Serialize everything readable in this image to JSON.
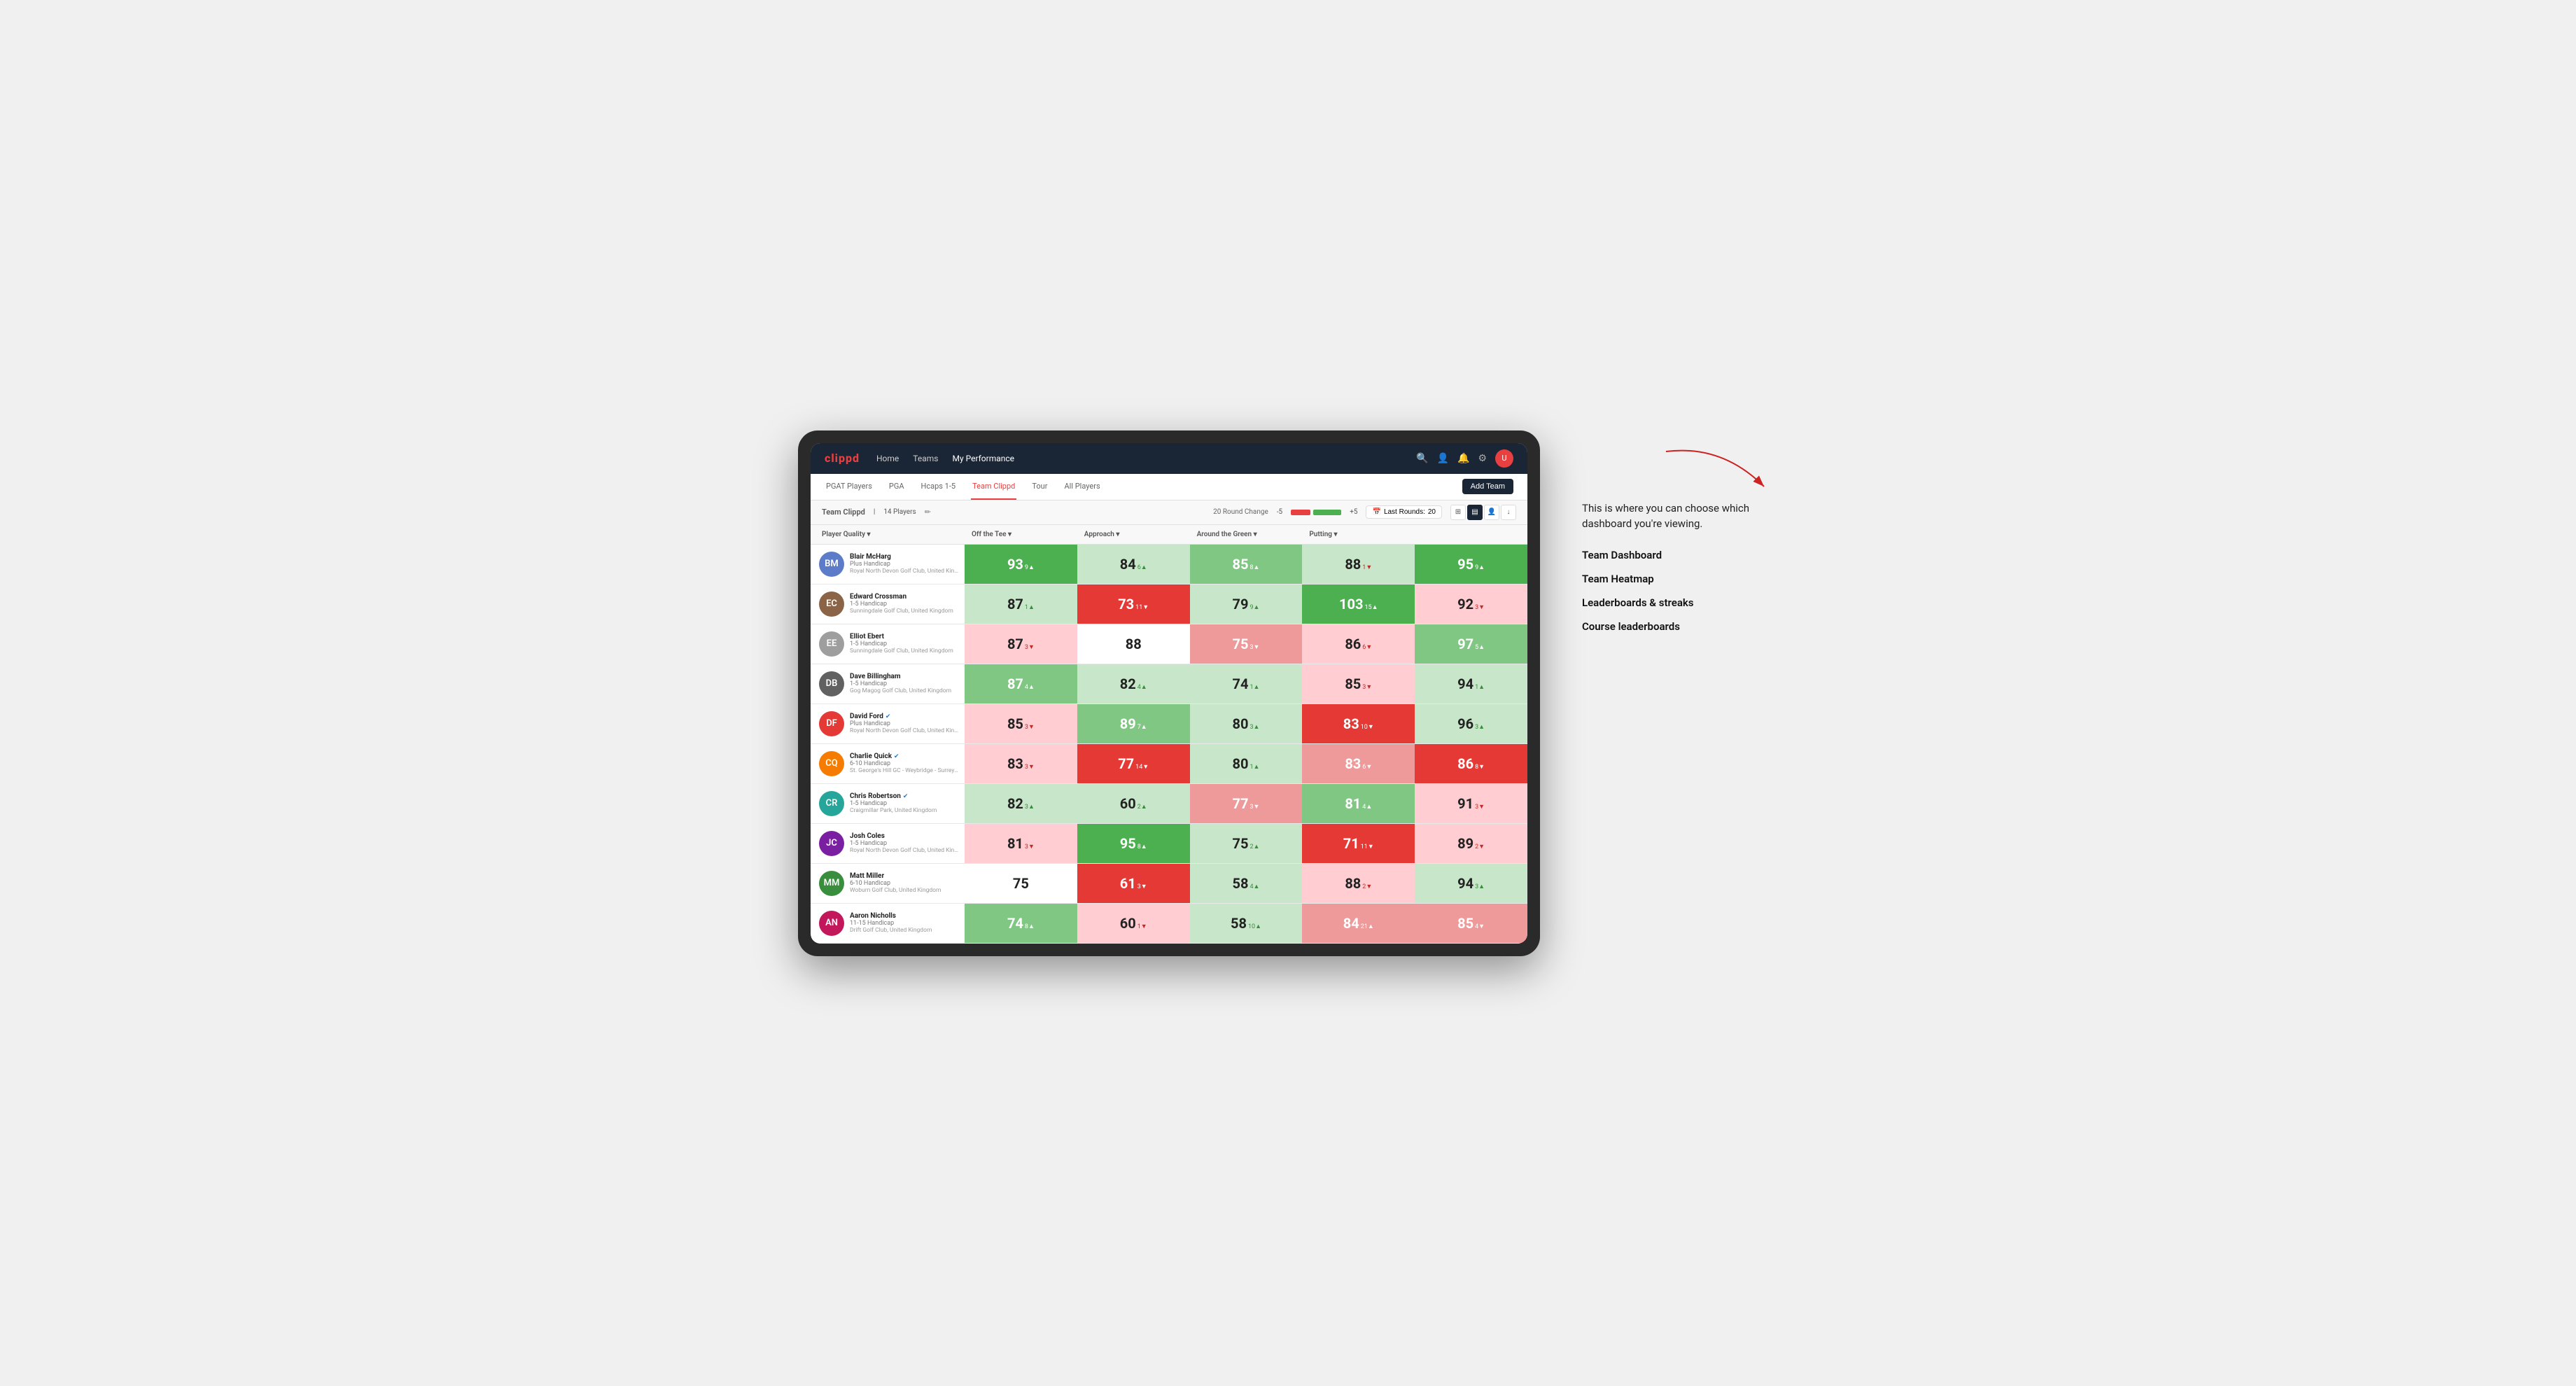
{
  "annotation": {
    "text": "This is where you can choose which dashboard you're viewing.",
    "items": [
      "Team Dashboard",
      "Team Heatmap",
      "Leaderboards & streaks",
      "Course leaderboards"
    ]
  },
  "nav": {
    "logo": "clippd",
    "links": [
      "Home",
      "Teams",
      "My Performance"
    ],
    "active_link": "My Performance"
  },
  "sub_nav": {
    "links": [
      "PGAT Players",
      "PGA",
      "Hcaps 1-5",
      "Team Clippd",
      "Tour",
      "All Players"
    ],
    "active": "Team Clippd",
    "add_team_label": "Add Team"
  },
  "table_controls": {
    "team_label": "Team Clippd",
    "player_count": "14 Players",
    "round_change_label": "20 Round Change",
    "change_low": "-5",
    "change_high": "+5",
    "last_rounds_label": "Last Rounds:",
    "last_rounds_value": "20"
  },
  "col_headers": [
    "Player Quality ▾",
    "Off the Tee ▾",
    "Approach ▾",
    "Around the Green ▾",
    "Putting ▾"
  ],
  "players": [
    {
      "name": "Blair McHarg",
      "handicap": "Plus Handicap",
      "club": "Royal North Devon Golf Club, United Kingdom",
      "avatar_color": "av-blue",
      "initials": "BM",
      "scores": [
        {
          "value": "93",
          "delta": "9",
          "dir": "up",
          "bg": "bg-green-strong"
        },
        {
          "value": "84",
          "delta": "6",
          "dir": "up",
          "bg": "bg-green-light"
        },
        {
          "value": "85",
          "delta": "8",
          "dir": "up",
          "bg": "bg-green-medium"
        },
        {
          "value": "88",
          "delta": "1",
          "dir": "down",
          "bg": "bg-green-light"
        },
        {
          "value": "95",
          "delta": "9",
          "dir": "up",
          "bg": "bg-green-strong"
        }
      ]
    },
    {
      "name": "Edward Crossman",
      "handicap": "1-5 Handicap",
      "club": "Sunningdale Golf Club, United Kingdom",
      "avatar_color": "av-brown",
      "initials": "EC",
      "scores": [
        {
          "value": "87",
          "delta": "1",
          "dir": "up",
          "bg": "bg-green-light"
        },
        {
          "value": "73",
          "delta": "11",
          "dir": "down",
          "bg": "bg-red-strong"
        },
        {
          "value": "79",
          "delta": "9",
          "dir": "up",
          "bg": "bg-green-light"
        },
        {
          "value": "103",
          "delta": "15",
          "dir": "up",
          "bg": "bg-green-strong"
        },
        {
          "value": "92",
          "delta": "3",
          "dir": "down",
          "bg": "bg-red-light"
        }
      ]
    },
    {
      "name": "Elliot Ebert",
      "handicap": "1-5 Handicap",
      "club": "Sunningdale Golf Club, United Kingdom",
      "avatar_color": "av-gray",
      "initials": "EE",
      "scores": [
        {
          "value": "87",
          "delta": "3",
          "dir": "down",
          "bg": "bg-red-light"
        },
        {
          "value": "88",
          "delta": "",
          "dir": "",
          "bg": "bg-white"
        },
        {
          "value": "75",
          "delta": "3",
          "dir": "down",
          "bg": "bg-red-medium"
        },
        {
          "value": "86",
          "delta": "6",
          "dir": "down",
          "bg": "bg-red-light"
        },
        {
          "value": "97",
          "delta": "5",
          "dir": "up",
          "bg": "bg-green-medium"
        }
      ]
    },
    {
      "name": "Dave Billingham",
      "handicap": "1-5 Handicap",
      "club": "Gog Magog Golf Club, United Kingdom",
      "avatar_color": "av-darkgray",
      "initials": "DB",
      "scores": [
        {
          "value": "87",
          "delta": "4",
          "dir": "up",
          "bg": "bg-green-medium"
        },
        {
          "value": "82",
          "delta": "4",
          "dir": "up",
          "bg": "bg-green-light"
        },
        {
          "value": "74",
          "delta": "1",
          "dir": "up",
          "bg": "bg-green-light"
        },
        {
          "value": "85",
          "delta": "3",
          "dir": "down",
          "bg": "bg-red-light"
        },
        {
          "value": "94",
          "delta": "1",
          "dir": "up",
          "bg": "bg-green-light"
        }
      ]
    },
    {
      "name": "David Ford",
      "handicap": "Plus Handicap",
      "club": "Royal North Devon Golf Club, United Kingdom",
      "avatar_color": "av-red",
      "initials": "DF",
      "verified": true,
      "scores": [
        {
          "value": "85",
          "delta": "3",
          "dir": "down",
          "bg": "bg-red-light"
        },
        {
          "value": "89",
          "delta": "7",
          "dir": "up",
          "bg": "bg-green-medium"
        },
        {
          "value": "80",
          "delta": "3",
          "dir": "up",
          "bg": "bg-green-light"
        },
        {
          "value": "83",
          "delta": "10",
          "dir": "down",
          "bg": "bg-red-strong"
        },
        {
          "value": "96",
          "delta": "3",
          "dir": "up",
          "bg": "bg-green-light"
        }
      ]
    },
    {
      "name": "Charlie Quick",
      "handicap": "6-10 Handicap",
      "club": "St. George's Hill GC - Weybridge - Surrey, Uni...",
      "avatar_color": "av-orange",
      "initials": "CQ",
      "verified": true,
      "scores": [
        {
          "value": "83",
          "delta": "3",
          "dir": "down",
          "bg": "bg-red-light"
        },
        {
          "value": "77",
          "delta": "14",
          "dir": "down",
          "bg": "bg-red-strong"
        },
        {
          "value": "80",
          "delta": "1",
          "dir": "up",
          "bg": "bg-green-light"
        },
        {
          "value": "83",
          "delta": "6",
          "dir": "down",
          "bg": "bg-red-medium"
        },
        {
          "value": "86",
          "delta": "8",
          "dir": "down",
          "bg": "bg-red-strong"
        }
      ]
    },
    {
      "name": "Chris Robertson",
      "handicap": "1-5 Handicap",
      "club": "Craigmillar Park, United Kingdom",
      "avatar_color": "av-teal",
      "initials": "CR",
      "verified": true,
      "scores": [
        {
          "value": "82",
          "delta": "3",
          "dir": "up",
          "bg": "bg-green-light"
        },
        {
          "value": "60",
          "delta": "2",
          "dir": "up",
          "bg": "bg-green-light"
        },
        {
          "value": "77",
          "delta": "3",
          "dir": "down",
          "bg": "bg-red-medium"
        },
        {
          "value": "81",
          "delta": "4",
          "dir": "up",
          "bg": "bg-green-medium"
        },
        {
          "value": "91",
          "delta": "3",
          "dir": "down",
          "bg": "bg-red-light"
        }
      ]
    },
    {
      "name": "Josh Coles",
      "handicap": "1-5 Handicap",
      "club": "Royal North Devon Golf Club, United Kingdom",
      "avatar_color": "av-purple",
      "initials": "JC",
      "scores": [
        {
          "value": "81",
          "delta": "3",
          "dir": "down",
          "bg": "bg-red-light"
        },
        {
          "value": "95",
          "delta": "8",
          "dir": "up",
          "bg": "bg-green-strong"
        },
        {
          "value": "75",
          "delta": "2",
          "dir": "up",
          "bg": "bg-green-light"
        },
        {
          "value": "71",
          "delta": "11",
          "dir": "down",
          "bg": "bg-red-strong"
        },
        {
          "value": "89",
          "delta": "2",
          "dir": "down",
          "bg": "bg-red-light"
        }
      ]
    },
    {
      "name": "Matt Miller",
      "handicap": "6-10 Handicap",
      "club": "Woburn Golf Club, United Kingdom",
      "avatar_color": "av-green",
      "initials": "MM",
      "scores": [
        {
          "value": "75",
          "delta": "",
          "dir": "",
          "bg": "bg-white"
        },
        {
          "value": "61",
          "delta": "3",
          "dir": "down",
          "bg": "bg-red-strong"
        },
        {
          "value": "58",
          "delta": "4",
          "dir": "up",
          "bg": "bg-green-light"
        },
        {
          "value": "88",
          "delta": "2",
          "dir": "down",
          "bg": "bg-red-light"
        },
        {
          "value": "94",
          "delta": "3",
          "dir": "up",
          "bg": "bg-green-light"
        }
      ]
    },
    {
      "name": "Aaron Nicholls",
      "handicap": "11-15 Handicap",
      "club": "Drift Golf Club, United Kingdom",
      "avatar_color": "av-pink",
      "initials": "AN",
      "scores": [
        {
          "value": "74",
          "delta": "8",
          "dir": "up",
          "bg": "bg-green-medium"
        },
        {
          "value": "60",
          "delta": "1",
          "dir": "down",
          "bg": "bg-red-light"
        },
        {
          "value": "58",
          "delta": "10",
          "dir": "up",
          "bg": "bg-green-light"
        },
        {
          "value": "84",
          "delta": "21",
          "dir": "up",
          "bg": "bg-red-medium"
        },
        {
          "value": "85",
          "delta": "4",
          "dir": "down",
          "bg": "bg-red-medium"
        }
      ]
    }
  ]
}
